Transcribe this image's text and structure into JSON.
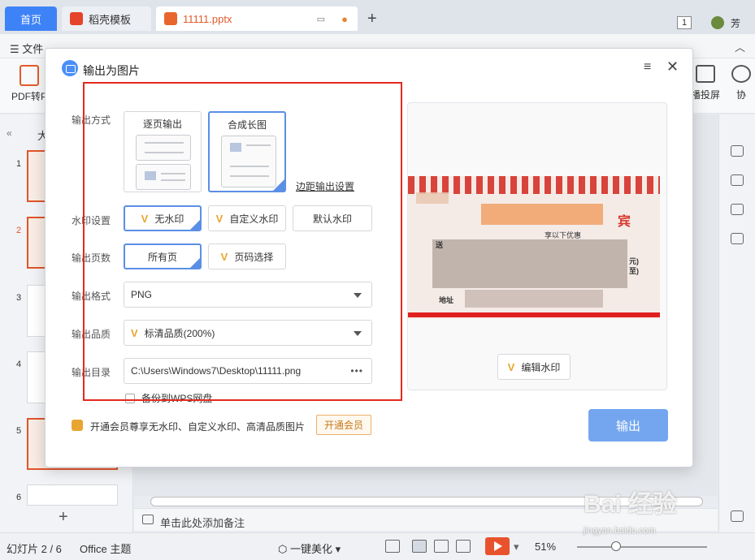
{
  "tabs": {
    "home": "首页",
    "daoke": "稻壳模板",
    "file": "11111.pptx"
  },
  "window": {
    "badge": "1",
    "user": "芳"
  },
  "menu": {
    "file": "文件"
  },
  "ribbon": {
    "pdf": "PDF转P",
    "screencast": "播投屏",
    "collab": "协"
  },
  "left_panel": {
    "tab_label": "大",
    "thumb_numbers": [
      "1",
      "2",
      "3",
      "4",
      "5",
      "6"
    ]
  },
  "dialog": {
    "title": "输出为图片",
    "labels": {
      "mode": "输出方式",
      "watermark": "水印设置",
      "pages": "输出页数",
      "format": "输出格式",
      "quality": "输出品质",
      "dir": "输出目录"
    },
    "mode_options": [
      "逐页输出",
      "合成长图"
    ],
    "margin_link": "边距输出设置",
    "watermark_options": [
      "无水印",
      "自定义水印",
      "默认水印"
    ],
    "page_options": [
      "所有页",
      "页码选择"
    ],
    "format_value": "PNG",
    "quality_value": "标清品质(200%)",
    "dir_value": "C:\\Users\\Windows7\\Desktop\\11111.png",
    "dir_more": "•••",
    "backup_label": "备份到WPS网盘",
    "edit_watermark": "编辑水印",
    "vip_text": "开通会员尊享无水印、自定义水印、高清品质图片",
    "vip_button": "开通会员",
    "export_button": "输出"
  },
  "preview": {
    "title_char": "宾",
    "line1": "送",
    "line2": "地址",
    "line3": "元)",
    "line4": "至)",
    "line5": "享以下优惠"
  },
  "notes": {
    "placeholder": "单击此处添加备注"
  },
  "status": {
    "slides": "幻灯片 2 / 6",
    "theme": "Office 主题",
    "beautify": "一键美化",
    "zoom": "51%"
  },
  "watermark": {
    "brand": "Bai 经验",
    "url": "jingyan.baidu.com"
  },
  "colors": {
    "accent": "#3e82f7",
    "selected_border": "#5b8fe6",
    "highlight_frame": "#e3281f",
    "export_button": "#73a6ef",
    "vip": "#e8a531"
  }
}
